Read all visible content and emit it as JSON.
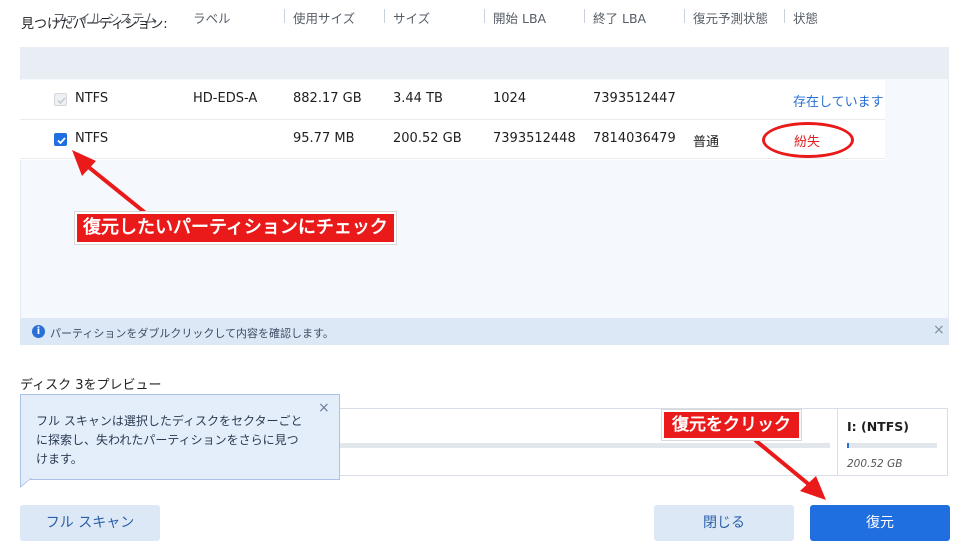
{
  "found_partitions_title": "見つけたパーティション:",
  "table": {
    "headers": [
      "ファイル システム",
      "ラベル",
      "使用サイズ",
      "サイズ",
      "開始 LBA",
      "終了 LBA",
      "復元予測状態",
      "状態"
    ],
    "rows": [
      {
        "checked": false,
        "disabled": true,
        "filesystem": "NTFS",
        "label": "HD-EDS-A",
        "used": "882.17 GB",
        "size": "3.44 TB",
        "start_lba": "1024",
        "end_lba": "7393512447",
        "predicted": "",
        "status": "存在しています",
        "status_color": "#2a6fd6"
      },
      {
        "checked": true,
        "disabled": false,
        "filesystem": "NTFS",
        "label": "",
        "used": "95.77 MB",
        "size": "200.52 GB",
        "start_lba": "7393512448",
        "end_lba": "7814036479",
        "predicted": "普通",
        "status": "紛失",
        "status_color": "#e02020"
      }
    ]
  },
  "info_bar": {
    "text": "パーティションをダブルクリックして内容を確認します。",
    "icon": "info-icon"
  },
  "preview": {
    "title": "ディスク 3をプレビュー",
    "partition_label": "I: (NTFS)",
    "partition_size": "200.52 GB",
    "tooltip_text": "フル スキャンは選択したディスクをセクターごとに探索し、失われたパーティションをさらに見つけます。"
  },
  "buttons": {
    "full_scan": "フル スキャン",
    "close": "閉じる",
    "recover": "復元"
  },
  "annotations": {
    "check_partition": "復元したいパーティションにチェック",
    "click_recover": "復元をクリック"
  },
  "colors": {
    "accent": "#1f6fe0",
    "annotation_red": "#ea1a1a",
    "lost_status": "#e02020",
    "exists_status": "#2a6fd6"
  }
}
